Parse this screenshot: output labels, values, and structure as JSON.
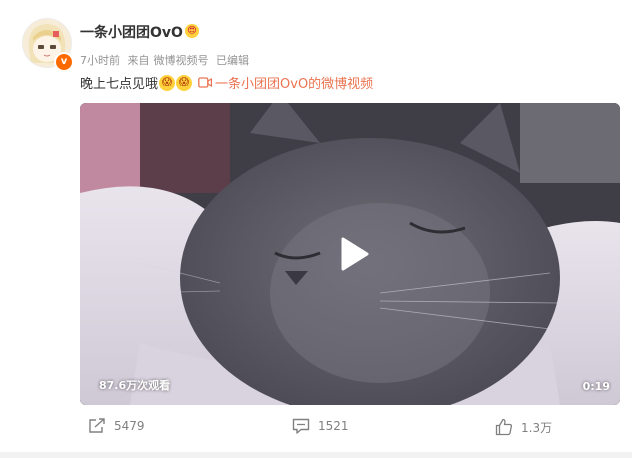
{
  "post": {
    "username": "一条小团团OvO",
    "username_emoji": "😍",
    "time": "7小时前",
    "source_prefix": "来自",
    "source": "微博视频号",
    "edited": "已编辑",
    "text": "晚上七点见哦",
    "emojis": [
      "😱",
      "😱"
    ],
    "video_link_text": "一条小团团OvO的微博视频",
    "avatar_badge": "v"
  },
  "video": {
    "views": "87.6万次观看",
    "duration": "0:19"
  },
  "actions": {
    "repost_count": "5479",
    "comment_count": "1521",
    "like_count": "1.3万"
  },
  "colors": {
    "link": "#eb7350",
    "badge": "#ff6a00",
    "meta": "#939393",
    "action": "#808080"
  },
  "icons": [
    "avatar-image",
    "verified-badge-icon",
    "emoji-icon",
    "video-camera-icon",
    "play-icon",
    "repost-icon",
    "comment-icon",
    "like-icon"
  ]
}
